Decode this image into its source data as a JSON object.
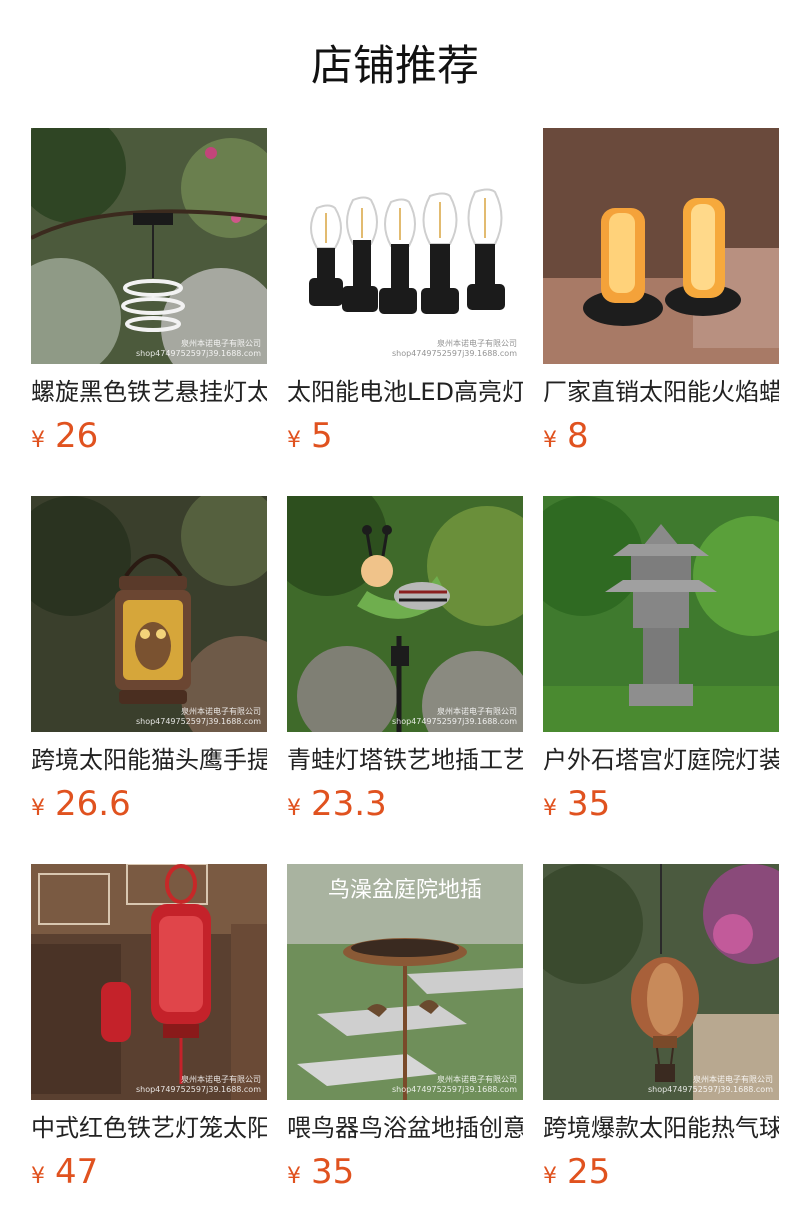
{
  "section": {
    "title": "店铺推荐",
    "currency_symbol": "¥"
  },
  "products": [
    {
      "name": "螺旋黑色铁艺悬挂灯太阳能",
      "price": "26",
      "watermark": [
        "泉州本诺电子有限公司",
        "shop4749752597j39.1688.com"
      ]
    },
    {
      "name": "太阳能电池LED高亮灯泡",
      "price": "5",
      "watermark": [
        "泉州本诺电子有限公司",
        "shop4749752597j39.1688.com"
      ]
    },
    {
      "name": "厂家直销太阳能火焰蜡烛灯",
      "price": "8",
      "watermark": []
    },
    {
      "name": "跨境太阳能猫头鹰手提灯",
      "price": "26.6",
      "watermark": [
        "泉州本诺电子有限公司",
        "shop4749752597j39.1688.com"
      ]
    },
    {
      "name": "青蛙灯塔铁艺地插工艺品",
      "price": "23.3",
      "watermark": [
        "泉州本诺电子有限公司",
        "shop4749752597j39.1688.com"
      ]
    },
    {
      "name": "户外石塔宫灯庭院灯装饰",
      "price": "35",
      "watermark": []
    },
    {
      "name": "中式红色铁艺灯笼太阳能",
      "price": "47",
      "watermark": [
        "泉州本诺电子有限公司",
        "shop4749752597j39.1688.com"
      ]
    },
    {
      "name": "喂鸟器鸟浴盆地插创意",
      "price": "35",
      "image_caption": "鸟澡盆庭院地插",
      "watermark": [
        "泉州本诺电子有限公司",
        "shop4749752597j39.1688.com"
      ]
    },
    {
      "name": "跨境爆款太阳能热气球灯",
      "price": "25",
      "watermark": [
        "泉州本诺电子有限公司",
        "shop4749752597j39.1688.com"
      ]
    }
  ],
  "colors": {
    "price": "#e0521f",
    "title": "#111111",
    "name": "#222222"
  }
}
